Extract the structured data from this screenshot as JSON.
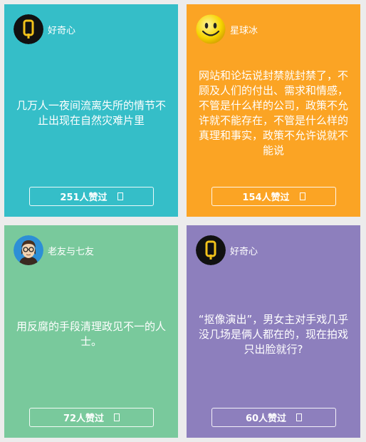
{
  "cards": [
    {
      "author": "好奇心",
      "avatar_icon": "q-logo-icon",
      "content": "几万人一夜间流离失所的情节不止出现在自然灾难片里",
      "likes": "251人赞过"
    },
    {
      "author": "星球冰",
      "avatar_icon": "smiley-face-icon",
      "content": "网站和论坛说封禁就封禁了，不顾及人们的付出、需求和情感，不管是什么样的公司，政策不允许就不能存在，不管是什么样的真理和事实，政策不允许说就不能说",
      "likes": "154人赞过"
    },
    {
      "author": "老友与七友",
      "avatar_icon": "glasses-person-icon",
      "content": "用反腐的手段清理政见不一的人士。",
      "likes": "72人赞过"
    },
    {
      "author": "好奇心",
      "avatar_icon": "q-logo-icon",
      "content": "“抠像演出”，男女主对手戏几乎没几场是俩人都在的，现在拍戏只出脸就行?",
      "likes": "60人赞过"
    }
  ],
  "colors": {
    "card1": "#35bec8",
    "card2": "#fba424",
    "card3": "#79c99c",
    "card4": "#8d7fbd"
  }
}
